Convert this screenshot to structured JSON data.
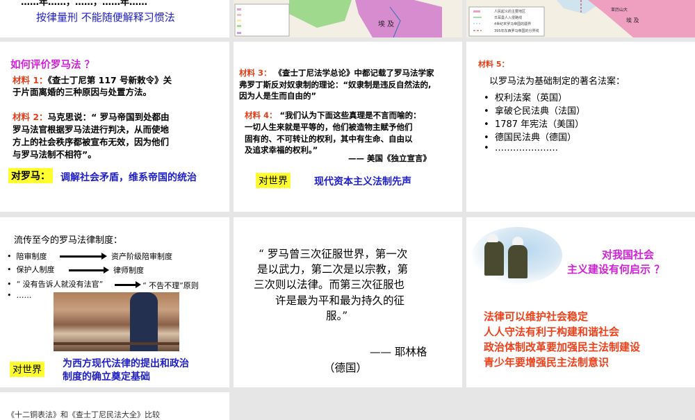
{
  "slides": {
    "s1": {
      "partial": "……年……，……，……年……",
      "summary": "按律量刑  不能随便解释习惯法"
    },
    "s2": {
      "label": "埃 及"
    },
    "s3": {
      "legend": [
        "人民起义的主要地区",
        "日耳曼人入侵路线",
        "4世纪末罗马帝国的疆界",
        "395年东西罗马帝国的分界线"
      ],
      "city": "亚历山大",
      "region": "埃 及"
    },
    "s4": {
      "title": "如何评价罗马法 ？",
      "m1_label": "材料 1：",
      "m1_l1": "《查士丁尼第 117 号新敕令》关",
      "m1_l2": "于片面离婚的三种原因与处置方法。",
      "m2_label": "材料 2：",
      "m2_l1": "马克思说：“ 罗马帝国到处都由",
      "m2_l2": "罗马法官根据罗马法进行判决，从而使地",
      "m2_l3": "方上的社会秩序都被宣布无效，因为他们",
      "m2_l4": "与罗马法制不相符”。",
      "tag": "对罗马：",
      "conclusion": "调解社会矛盾，维系帝国的统治"
    },
    "s5": {
      "m3_label": "材料 3：",
      "m3_l1": "《查士丁尼法学总论》中都记载了罗马法学家",
      "m3_l2": "弗罗丁斯反对奴隶制的理论：“奴隶制是违反自然法的,",
      "m3_l3": "因为人是生而自由的”",
      "m4_label": "材料 4：",
      "m4_l1": "“我们认为下面这些真理是不言而喻的：",
      "m4_l2": "一切人生来就是平等的，他们被造物主赋予他们",
      "m4_l3": "固有的、不可转让的权利，其中有生命、自由以",
      "m4_l4": "及追求幸福的权利。”",
      "source": "—— 美国《独立宣言》",
      "tag": "对世界",
      "conclusion": "现代资本主义法制先声"
    },
    "s6": {
      "m5_label": "材料 5：",
      "intro": "以罗马法为基础制定的著名法案：",
      "items": [
        "权利法案（英国）",
        "拿破仑民法典（法国）",
        "1787 年宪法（美国）",
        "德国民法典（德国）",
        "…………………"
      ]
    },
    "s7": {
      "title": "流传至今的罗马法律制度：",
      "rows": [
        {
          "from": "陪审制度",
          "to": "资产阶级陪审制度"
        },
        {
          "from": "保护人制度",
          "to": "律师制度"
        },
        {
          "from": "“ 没有告诉人就没有法官”",
          "to": "“ 不告不理”原则"
        }
      ],
      "more": "……",
      "tag": "对世界",
      "conclusion_l1": "为西方现代法律的提出和政治",
      "conclusion_l2": "制度的确立奠定基础"
    },
    "s8": {
      "l1": "“ 罗马曾三次征服世界，第一次",
      "l2": "是以武力，第二次是以宗教，第",
      "l3": "三次则以法律。而第三次征服也",
      "l4": "许是最为平和最为持久的征",
      "l5": "服。”",
      "author": "—— 耶林格",
      "country": "（德国）"
    },
    "s9": {
      "q1": "对我国社会",
      "q2": "主义建设有何启示 ？",
      "points": [
        "法律可以维护社会稳定",
        "人人守法有利于构建和谐社会",
        "政治体制改革要加强民主法制建设",
        "青少年要增强民主法制意识"
      ]
    },
    "s10": {
      "title": "《十二铜表法》和《查士丁尼民法大全》比较"
    }
  }
}
